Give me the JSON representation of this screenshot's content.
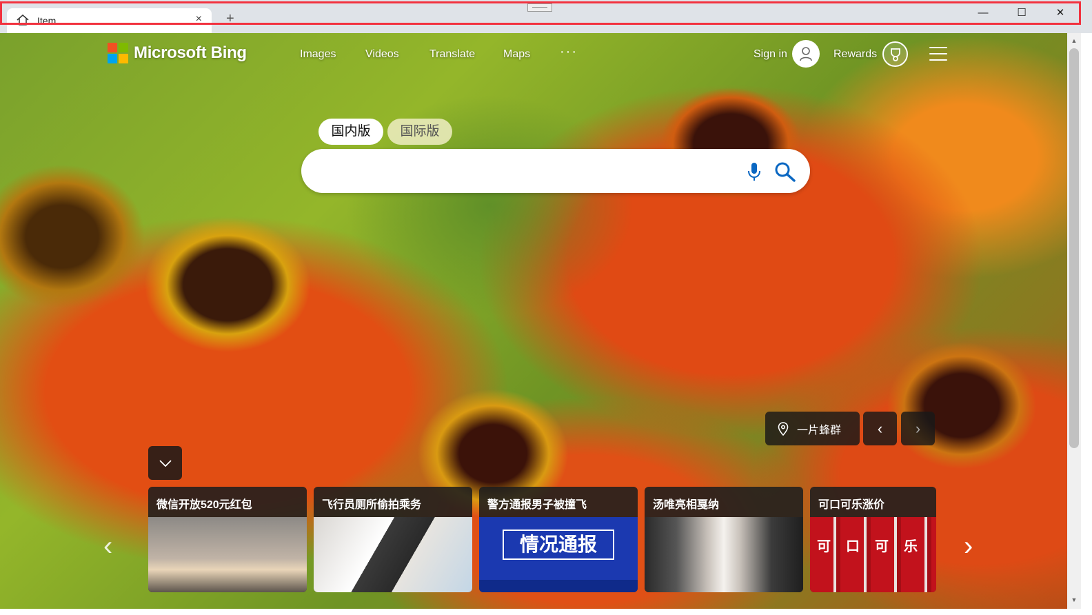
{
  "browser": {
    "tab_title": "Item",
    "tab_close": "×",
    "new_tab": "+",
    "window_minimize": "—",
    "window_maximize": "☐",
    "window_close": "✕"
  },
  "header": {
    "logo_text": "Microsoft Bing",
    "logo_colors": [
      "#f25022",
      "#7fba00",
      "#00a4ef",
      "#ffb900"
    ],
    "nav": [
      "Images",
      "Videos",
      "Translate",
      "Maps"
    ],
    "more": "···",
    "sign_in": "Sign in",
    "rewards": "Rewards"
  },
  "search": {
    "tabs": [
      "国内版",
      "国际版"
    ],
    "active_tab": "国内版",
    "placeholder": "",
    "value": ""
  },
  "image_info": {
    "location_label": "一片蜂群",
    "prev": "‹",
    "next": "›"
  },
  "carousel": {
    "prev": "‹",
    "next": "›",
    "cards": [
      {
        "title": "微信开放520元红包"
      },
      {
        "title": "飞行员厕所偷拍乘务"
      },
      {
        "title": "警方通报男子被撞飞",
        "thumb_text": "情况通报"
      },
      {
        "title": "汤唯亮相戛纳"
      },
      {
        "title": "可口可乐涨价",
        "thumb_text": "可口可乐"
      }
    ]
  }
}
